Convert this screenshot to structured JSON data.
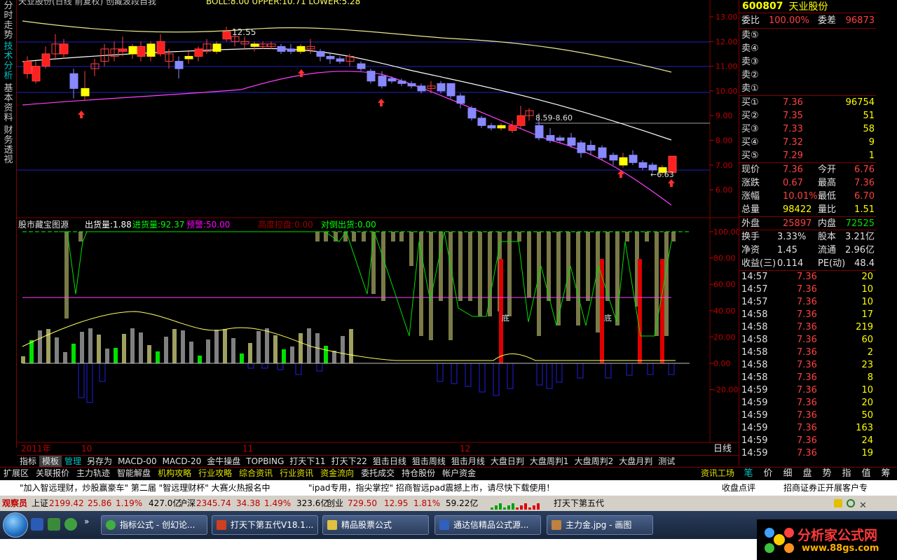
{
  "window": {
    "title": "天业股份(日线 前复权) 创藏波段自我"
  },
  "left_tabs": [
    "分时走势",
    "技术分析",
    "基本资料",
    "财务透视"
  ],
  "top_chart": {
    "title": "天业股份(日线 前复权) 创藏波段自我",
    "indicator": "BOLL:8.00  UPPER:10.71  LOWER:5.28",
    "y_ticks": [
      "13.00",
      "12.00",
      "11.00",
      "10.00",
      "9.00",
      "8.00",
      "7.00",
      "6.00"
    ],
    "annotations": [
      "12.55",
      "8.59-8.60",
      "←6.63"
    ]
  },
  "sub_chart": {
    "name": "股市藏宝图源",
    "fields": [
      {
        "label": "出货量:1.88",
        "color": "#ffffff"
      },
      {
        "label": "进货量:92.37",
        "color": "#00ff00"
      },
      {
        "label": "预警:50.00",
        "color": "#ff00ff"
      },
      {
        "label": "高度控盘:0.00",
        "color": "#a00000"
      },
      {
        "label": "对倒出货:0.00",
        "color": "#00ff00"
      }
    ],
    "y_ticks": [
      "100.00",
      "80.00",
      "60.00",
      "40.00",
      "20.00",
      "0.00",
      "-20.00"
    ],
    "marks": [
      "底",
      "底"
    ]
  },
  "x_axis": [
    "2011年",
    "10",
    "11",
    "12"
  ],
  "period_label": "日线",
  "quote": {
    "code": "600807",
    "name": "天业股份",
    "weibi_label": "委比",
    "weibi": "100.00%",
    "weicha_label": "委差",
    "weicha": "96873",
    "sell": [
      {
        "label": "卖⑤",
        "price": "",
        "vol": ""
      },
      {
        "label": "卖④",
        "price": "",
        "vol": ""
      },
      {
        "label": "卖③",
        "price": "",
        "vol": ""
      },
      {
        "label": "卖②",
        "price": "",
        "vol": ""
      },
      {
        "label": "卖①",
        "price": "",
        "vol": ""
      }
    ],
    "buy": [
      {
        "label": "买①",
        "price": "7.36",
        "vol": "96754"
      },
      {
        "label": "买②",
        "price": "7.35",
        "vol": "51"
      },
      {
        "label": "买③",
        "price": "7.33",
        "vol": "58"
      },
      {
        "label": "买④",
        "price": "7.32",
        "vol": "9"
      },
      {
        "label": "买⑤",
        "price": "7.29",
        "vol": "1"
      }
    ],
    "stats": [
      {
        "l1": "现价",
        "v1": "7.36",
        "l2": "今开",
        "v2": "6.76"
      },
      {
        "l1": "涨跌",
        "v1": "0.67",
        "l2": "最高",
        "v2": "7.36"
      },
      {
        "l1": "涨幅",
        "v1": "10.01%",
        "l2": "最低",
        "v2": "6.70"
      },
      {
        "l1": "总量",
        "v1": "98422",
        "l2": "量比",
        "v2": "1.51"
      }
    ],
    "outer_label": "外盘",
    "outer": "25897",
    "inner_label": "内盘",
    "inner": "72525",
    "fund": [
      {
        "l1": "换手",
        "v1": "3.33%",
        "l2": "股本",
        "v2": "3.21亿"
      },
      {
        "l1": "净资",
        "v1": "1.45",
        "l2": "流通",
        "v2": "2.96亿"
      },
      {
        "l1": "收益(三)",
        "v1": "0.114",
        "l2": "PE(动)",
        "v2": "48.4"
      }
    ],
    "ticks": [
      {
        "t": "14:57",
        "p": "7.36",
        "v": "20"
      },
      {
        "t": "14:57",
        "p": "7.36",
        "v": "10"
      },
      {
        "t": "14:57",
        "p": "7.36",
        "v": "10"
      },
      {
        "t": "14:58",
        "p": "7.36",
        "v": "17"
      },
      {
        "t": "14:58",
        "p": "7.36",
        "v": "219"
      },
      {
        "t": "14:58",
        "p": "7.36",
        "v": "60"
      },
      {
        "t": "14:58",
        "p": "7.36",
        "v": "2"
      },
      {
        "t": "14:58",
        "p": "7.36",
        "v": "23"
      },
      {
        "t": "14:58",
        "p": "7.36",
        "v": "8"
      },
      {
        "t": "14:59",
        "p": "7.36",
        "v": "10"
      },
      {
        "t": "14:59",
        "p": "7.36",
        "v": "20"
      },
      {
        "t": "14:59",
        "p": "7.36",
        "v": "50"
      },
      {
        "t": "14:59",
        "p": "7.36",
        "v": "163"
      },
      {
        "t": "14:59",
        "p": "7.36",
        "v": "24"
      },
      {
        "t": "14:59",
        "p": "7.36",
        "v": "19"
      }
    ]
  },
  "tabs_row1": [
    "指标",
    "模板",
    "管理",
    "另存为",
    "MACD-00",
    "MACD-20",
    "金牛操盘",
    "TOPBING",
    "打天下11",
    "打天下22",
    "狙击日线",
    "狙击周线",
    "狙击月线",
    "大盘日判",
    "大盘周判1",
    "大盘周判2",
    "大盘月判",
    "测试"
  ],
  "tabs_row2": [
    "扩展区",
    "关联报价",
    "主力轨迹",
    "智能解盘",
    "机构攻略",
    "行业攻略",
    "综合资讯",
    "行业资讯",
    "资金流向",
    "委托成交",
    "持仓股份",
    "帐户资金"
  ],
  "info_tab": "资讯工场",
  "right_bottom_tabs": [
    "笔",
    "价",
    "细",
    "盘",
    "势",
    "指",
    "值",
    "筹"
  ],
  "ticker": {
    "a": "\"加入智远理财，炒股赢豪车\" 第二届 \"智远理财杯\" 大赛火热报名中",
    "b": "\"ipad专用，指尖掌控\" 招商智远pad震撼上市，请尽快下载使用！",
    "c": "收盘点评",
    "d": "招商证券正开展客户专"
  },
  "status": {
    "role": "观察员",
    "sh_name": "上证",
    "sh_val": "2199.42",
    "sh_chg": "25.86",
    "sh_pct": "1.19%",
    "sh_amt": "427.0亿",
    "sz_name": "沪深",
    "sz_val": "2345.74",
    "sz_chg": "34.38",
    "sz_pct": "1.49%",
    "sz_amt": "323.6亿",
    "cy_name": "创业",
    "cy_val": "729.50",
    "cy_chg": "12.95",
    "cy_pct": "1.81%",
    "cy_amt": "59.22亿",
    "app": "打天下第五代"
  },
  "taskbar": {
    "tasks": [
      "指标公式 - 创幻论...",
      "打天下第五代V18.1...",
      "精品股票公式",
      "通达信精品公式源...",
      "主力金.jpg - 画图"
    ]
  },
  "watermark": {
    "site": "分析家公式网",
    "url": "www.88gs.com"
  },
  "colors": {
    "up": "#ff4040",
    "down": "#8080ff",
    "mid": "#ffffff",
    "upper": "#e8e890",
    "lower": "#ff40ff",
    "yellow_bar": "#ffff00"
  }
}
